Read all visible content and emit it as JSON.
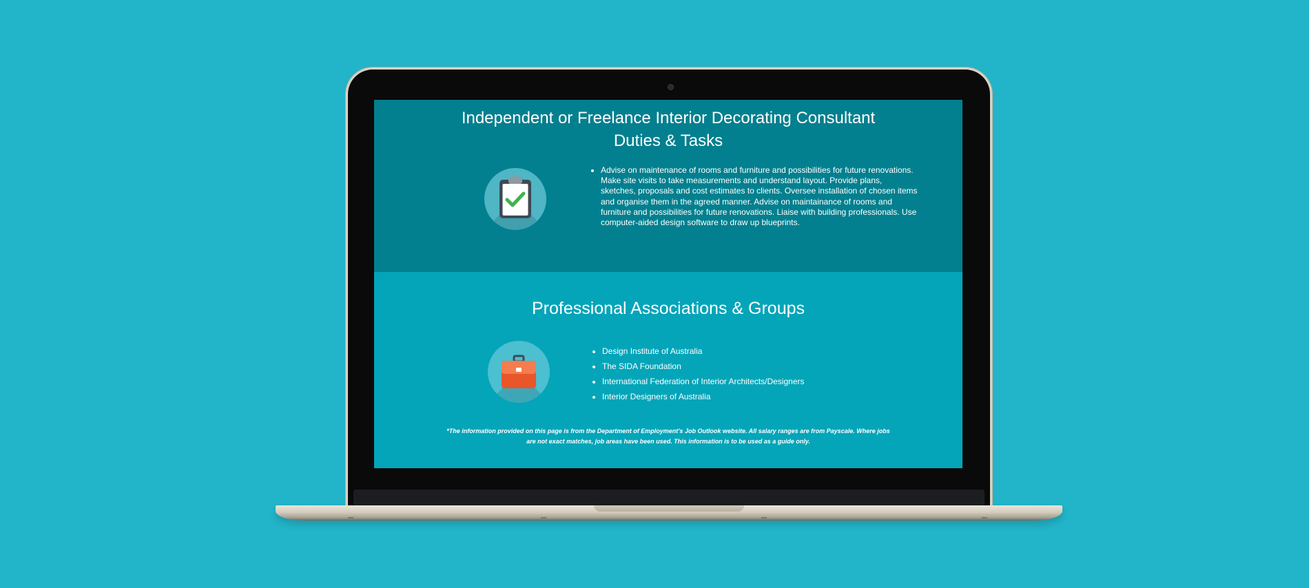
{
  "colors": {
    "background": "#22b4c8",
    "section_dark": "#03808f",
    "section_light": "#04a5b9",
    "check_green": "#3fb24f",
    "briefcase_orange": "#f26b3a"
  },
  "duties": {
    "title_line1": "Independent or Freelance Interior Decorating Consultant",
    "title_line2": "Duties & Tasks",
    "icon": "clipboard-check-icon",
    "items": [
      "Advise on maintenance of rooms and furniture and possibilities for future renovations. Make site visits to take measurements and understand layout. Provide plans, sketches, proposals and cost estimates to clients. Oversee installation of chosen items and organise them in the agreed manner. Advise on maintainance of rooms and furniture and possibilities for future renovations. Liaise with building professionals. Use computer-aided design software to draw up blueprints."
    ]
  },
  "associations": {
    "title": "Professional Associations & Groups",
    "icon": "briefcase-icon",
    "items": [
      "Design Institute of Australia",
      "The SIDA Foundation",
      "International Federation of Interior Architects/Designers",
      "Interior Designers of Australia"
    ]
  },
  "disclaimer": "*The information provided on this page is from the Department of Employment's Job Outlook website. All salary ranges are from Payscale. Where jobs are not exact matches, job areas have been used. This information is to be used as a guide only."
}
